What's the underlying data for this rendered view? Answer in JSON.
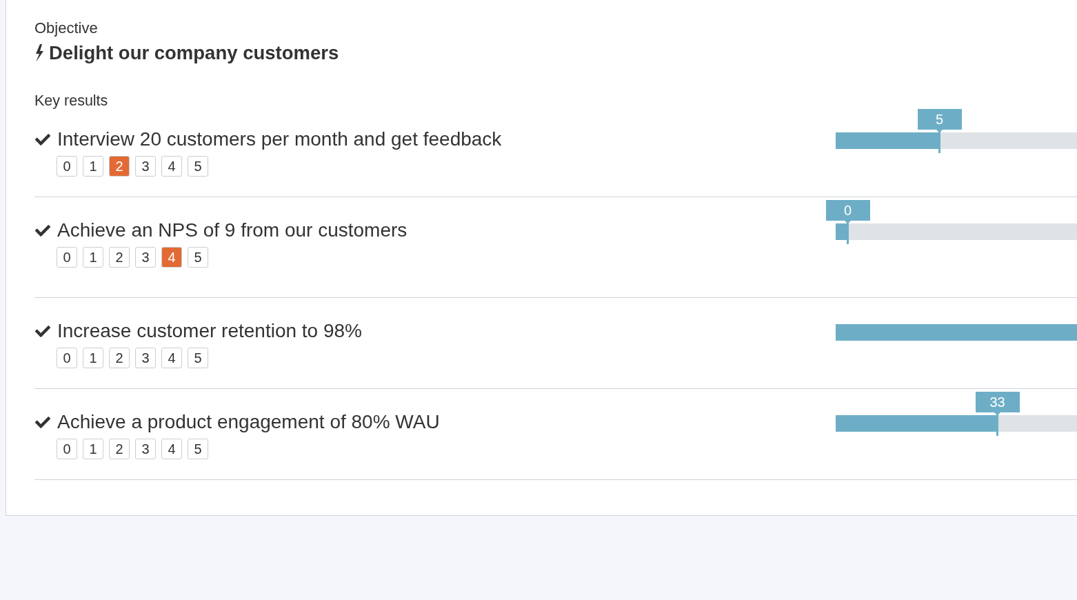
{
  "objective": {
    "label": "Objective",
    "title": "Delight our company customers"
  },
  "key_results": {
    "label": "Key results",
    "items": [
      {
        "title": "Interview 20 customers per month and get feedback",
        "scores": [
          {
            "label": "0",
            "selected": false
          },
          {
            "label": "1",
            "selected": false
          },
          {
            "label": "2",
            "selected": true
          },
          {
            "label": "3",
            "selected": false
          },
          {
            "label": "4",
            "selected": false
          },
          {
            "label": "5",
            "selected": false
          }
        ],
        "progress": {
          "level": 0.43,
          "value_label": "5"
        }
      },
      {
        "title": "Achieve an NPS of 9 from our customers",
        "scores": [
          {
            "label": "0",
            "selected": false
          },
          {
            "label": "1",
            "selected": false
          },
          {
            "label": "2",
            "selected": false
          },
          {
            "label": "3",
            "selected": false
          },
          {
            "label": "4",
            "selected": true
          },
          {
            "label": "5",
            "selected": false
          }
        ],
        "progress": {
          "level": 0.05,
          "value_label": "0"
        }
      },
      {
        "title": "Increase customer retention to 98%",
        "scores": [
          {
            "label": "0",
            "selected": false
          },
          {
            "label": "1",
            "selected": false
          },
          {
            "label": "2",
            "selected": false
          },
          {
            "label": "3",
            "selected": false
          },
          {
            "label": "4",
            "selected": false
          },
          {
            "label": "5",
            "selected": false
          }
        ],
        "progress": {
          "level": 1
        }
      },
      {
        "title": "Achieve a product engagement of 80% WAU",
        "scores": [
          {
            "label": "0",
            "selected": false
          },
          {
            "label": "1",
            "selected": false
          },
          {
            "label": "2",
            "selected": false
          },
          {
            "label": "3",
            "selected": false
          },
          {
            "label": "4",
            "selected": false
          },
          {
            "label": "5",
            "selected": false
          }
        ],
        "progress": {
          "level": 0.67,
          "value_label": "33"
        }
      }
    ]
  }
}
